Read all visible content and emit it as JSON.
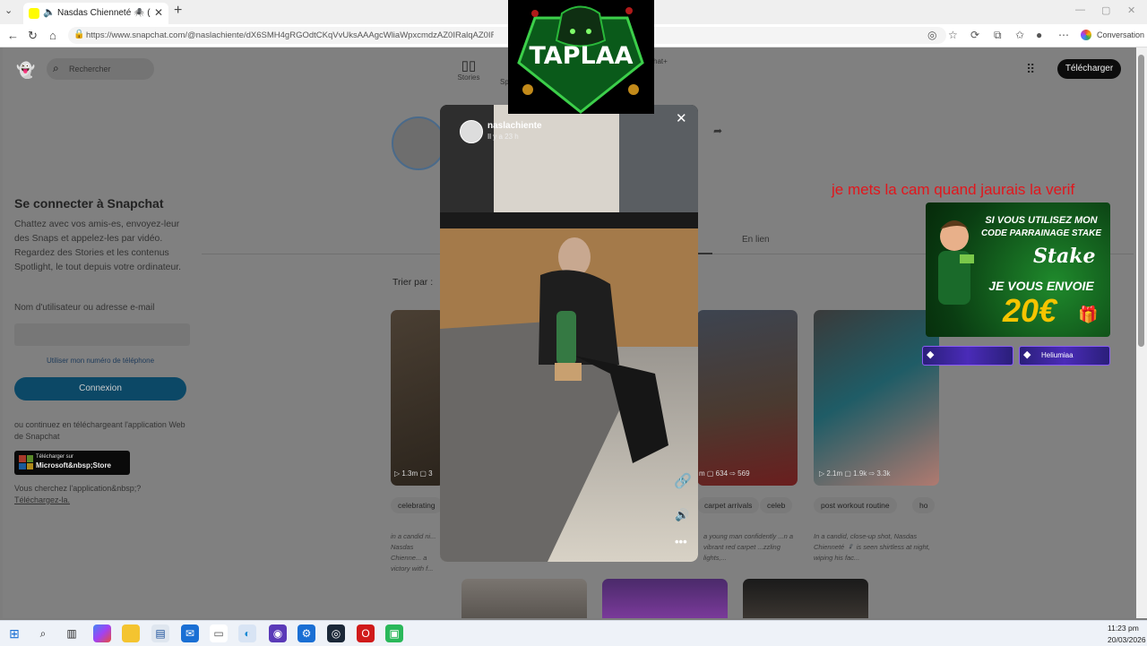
{
  "browser": {
    "tab_title": "Nasdas Chienneté 🕷️ (@nasl...",
    "url": "https://www.snapchat.com/@naslachiente/dX6SMH4gRGOdtCKqVvUksAAAgcWliaWpxcmdzAZ0IRalqAZ0IRNVPAA...",
    "conversation_label": "Conversation"
  },
  "snapchat": {
    "search_placeholder": "Rechercher",
    "nav_stories": "Stories",
    "nav_sp": "Sp",
    "nav_snapplus": "chat+",
    "download_button": "Télécharger",
    "login": {
      "title": "Se connecter à Snapchat",
      "description": "Chattez avec vos amis-es, envoyez-leur des Snaps et appelez-les par vidéo. Regardez des Stories et les contenus Spotlight, le tout depuis votre ordinateur.",
      "username_label": "Nom d'utilisateur ou adresse e-mail",
      "phone_link": "Utiliser mon numéro de téléphone",
      "connect_button": "Connexion",
      "app_text": "ou continuez en téléchargeant l'application Web de Snapchat",
      "ms_small": "Télécharger sur",
      "ms_big": "Microsoft&nbsp;Store",
      "search_app": "Vous cherchez l'application&nbsp;?",
      "download_link": "Téléchargez-la."
    },
    "tab_enlien": "En lien",
    "sort_label": "Trier par :",
    "cards": [
      {
        "stats": "▷ 1.3m ▢ 3",
        "tag": "celebrating",
        "desc": "in a candid ni... Nasdas Chienne... a victory with f..."
      },
      {
        "stats": "m ▢ 634 ⇨ 569",
        "tag": "carpet arrivals",
        "tag2": "celeb",
        "desc": "a young man confidently ...n a vibrant red carpet ...zzling lights,..."
      },
      {
        "stats": "▷ 2.1m ▢ 1.9k ⇨ 3.3k",
        "tag": "post workout routine",
        "tag2": "ho",
        "desc": "In a candid, close-up shot, Nasdas Chienneté 🕷️ is seen shirtless at night, wiping his fac..."
      }
    ]
  },
  "story": {
    "username": "naslachiente",
    "time": "Il y a 23 h"
  },
  "overlay": {
    "logo_text": "TAPLAA",
    "message": "je mets la cam quand jaurais la verif",
    "promo_line1": "SI VOUS UTILISEZ MON",
    "promo_line2": "CODE PARRAINAGE STAKE",
    "promo_brand": "Stake",
    "promo_line3": "JE VOUS ENVOIE",
    "promo_amount": "20€",
    "badge2_label": "Heliumiaa"
  },
  "taskbar": {
    "time": "11:23 pm",
    "date": "20/03/2026"
  }
}
